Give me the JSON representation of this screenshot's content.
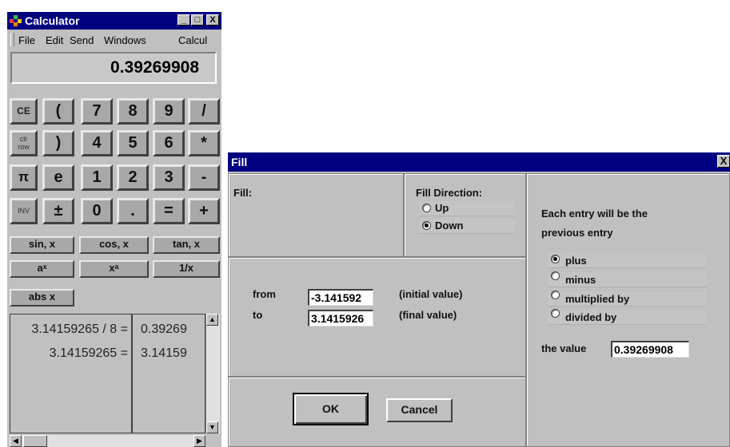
{
  "calculator": {
    "title": "Calculator",
    "window_buttons": {
      "minimize": "_",
      "maximize": "□",
      "close": "X"
    },
    "menu": [
      "File",
      "Edit",
      "Send",
      "Windows",
      "Calcul"
    ],
    "display": "0.39269908",
    "keys": {
      "ce": "CE",
      "lparen": "(",
      "k7": "7",
      "k8": "8",
      "k9": "9",
      "div": "/",
      "clr_row": "clr\nrow",
      "rparen": ")",
      "k4": "4",
      "k5": "5",
      "k6": "6",
      "mul": "*",
      "pi": "π",
      "e": "e",
      "k1": "1",
      "k2": "2",
      "k3": "3",
      "minus": "-",
      "inv": "INV",
      "plusminus": "±",
      "k0": "0",
      "dot": ".",
      "eq": "=",
      "plus": "+",
      "sin": "sin, x",
      "cos": "cos, x",
      "tan": "tan, x",
      "ax": "aˣ",
      "xa": "xᵃ",
      "recip": "1/x",
      "abs": "abs x"
    },
    "history": {
      "expressions": [
        "3.14159265 / 8 =",
        "3.14159265 ="
      ],
      "results": [
        "0.39269",
        "3.14159"
      ]
    }
  },
  "fill_dialog": {
    "title": "Fill",
    "close": "X",
    "fill_label": "Fill:",
    "direction": {
      "label": "Fill Direction:",
      "options": [
        "Up",
        "Down"
      ],
      "selected": "Down"
    },
    "from": {
      "label": "from",
      "value": "-3.141592",
      "note": "(initial value)"
    },
    "to": {
      "label": "to",
      "value": "3.1415926",
      "note": "(final value)"
    },
    "operation": {
      "label_line1": "Each entry will be the",
      "label_line2": "previous entry",
      "options": [
        "plus",
        "minus",
        "multiplied by",
        "divided by"
      ],
      "selected": "plus"
    },
    "value": {
      "label": "the value",
      "value": "0.39269908"
    },
    "ok": "OK",
    "cancel": "Cancel"
  }
}
